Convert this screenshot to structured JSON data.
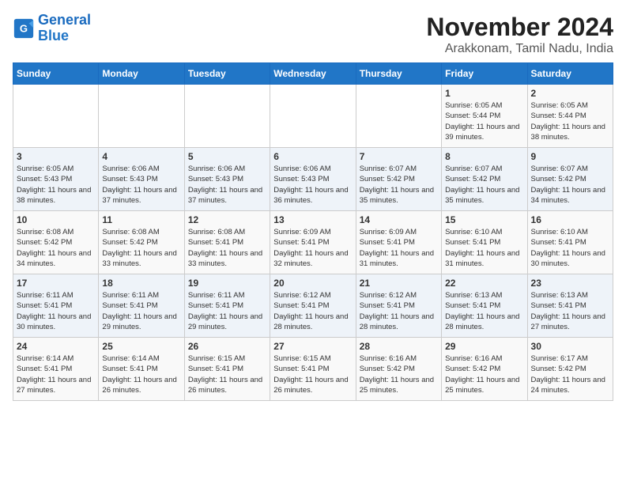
{
  "logo": {
    "line1": "General",
    "line2": "Blue"
  },
  "title": "November 2024",
  "location": "Arakkonam, Tamil Nadu, India",
  "weekdays": [
    "Sunday",
    "Monday",
    "Tuesday",
    "Wednesday",
    "Thursday",
    "Friday",
    "Saturday"
  ],
  "weeks": [
    [
      {
        "day": "",
        "info": ""
      },
      {
        "day": "",
        "info": ""
      },
      {
        "day": "",
        "info": ""
      },
      {
        "day": "",
        "info": ""
      },
      {
        "day": "",
        "info": ""
      },
      {
        "day": "1",
        "info": "Sunrise: 6:05 AM\nSunset: 5:44 PM\nDaylight: 11 hours and 39 minutes."
      },
      {
        "day": "2",
        "info": "Sunrise: 6:05 AM\nSunset: 5:44 PM\nDaylight: 11 hours and 38 minutes."
      }
    ],
    [
      {
        "day": "3",
        "info": "Sunrise: 6:05 AM\nSunset: 5:43 PM\nDaylight: 11 hours and 38 minutes."
      },
      {
        "day": "4",
        "info": "Sunrise: 6:06 AM\nSunset: 5:43 PM\nDaylight: 11 hours and 37 minutes."
      },
      {
        "day": "5",
        "info": "Sunrise: 6:06 AM\nSunset: 5:43 PM\nDaylight: 11 hours and 37 minutes."
      },
      {
        "day": "6",
        "info": "Sunrise: 6:06 AM\nSunset: 5:43 PM\nDaylight: 11 hours and 36 minutes."
      },
      {
        "day": "7",
        "info": "Sunrise: 6:07 AM\nSunset: 5:42 PM\nDaylight: 11 hours and 35 minutes."
      },
      {
        "day": "8",
        "info": "Sunrise: 6:07 AM\nSunset: 5:42 PM\nDaylight: 11 hours and 35 minutes."
      },
      {
        "day": "9",
        "info": "Sunrise: 6:07 AM\nSunset: 5:42 PM\nDaylight: 11 hours and 34 minutes."
      }
    ],
    [
      {
        "day": "10",
        "info": "Sunrise: 6:08 AM\nSunset: 5:42 PM\nDaylight: 11 hours and 34 minutes."
      },
      {
        "day": "11",
        "info": "Sunrise: 6:08 AM\nSunset: 5:42 PM\nDaylight: 11 hours and 33 minutes."
      },
      {
        "day": "12",
        "info": "Sunrise: 6:08 AM\nSunset: 5:41 PM\nDaylight: 11 hours and 33 minutes."
      },
      {
        "day": "13",
        "info": "Sunrise: 6:09 AM\nSunset: 5:41 PM\nDaylight: 11 hours and 32 minutes."
      },
      {
        "day": "14",
        "info": "Sunrise: 6:09 AM\nSunset: 5:41 PM\nDaylight: 11 hours and 31 minutes."
      },
      {
        "day": "15",
        "info": "Sunrise: 6:10 AM\nSunset: 5:41 PM\nDaylight: 11 hours and 31 minutes."
      },
      {
        "day": "16",
        "info": "Sunrise: 6:10 AM\nSunset: 5:41 PM\nDaylight: 11 hours and 30 minutes."
      }
    ],
    [
      {
        "day": "17",
        "info": "Sunrise: 6:11 AM\nSunset: 5:41 PM\nDaylight: 11 hours and 30 minutes."
      },
      {
        "day": "18",
        "info": "Sunrise: 6:11 AM\nSunset: 5:41 PM\nDaylight: 11 hours and 29 minutes."
      },
      {
        "day": "19",
        "info": "Sunrise: 6:11 AM\nSunset: 5:41 PM\nDaylight: 11 hours and 29 minutes."
      },
      {
        "day": "20",
        "info": "Sunrise: 6:12 AM\nSunset: 5:41 PM\nDaylight: 11 hours and 28 minutes."
      },
      {
        "day": "21",
        "info": "Sunrise: 6:12 AM\nSunset: 5:41 PM\nDaylight: 11 hours and 28 minutes."
      },
      {
        "day": "22",
        "info": "Sunrise: 6:13 AM\nSunset: 5:41 PM\nDaylight: 11 hours and 28 minutes."
      },
      {
        "day": "23",
        "info": "Sunrise: 6:13 AM\nSunset: 5:41 PM\nDaylight: 11 hours and 27 minutes."
      }
    ],
    [
      {
        "day": "24",
        "info": "Sunrise: 6:14 AM\nSunset: 5:41 PM\nDaylight: 11 hours and 27 minutes."
      },
      {
        "day": "25",
        "info": "Sunrise: 6:14 AM\nSunset: 5:41 PM\nDaylight: 11 hours and 26 minutes."
      },
      {
        "day": "26",
        "info": "Sunrise: 6:15 AM\nSunset: 5:41 PM\nDaylight: 11 hours and 26 minutes."
      },
      {
        "day": "27",
        "info": "Sunrise: 6:15 AM\nSunset: 5:41 PM\nDaylight: 11 hours and 26 minutes."
      },
      {
        "day": "28",
        "info": "Sunrise: 6:16 AM\nSunset: 5:42 PM\nDaylight: 11 hours and 25 minutes."
      },
      {
        "day": "29",
        "info": "Sunrise: 6:16 AM\nSunset: 5:42 PM\nDaylight: 11 hours and 25 minutes."
      },
      {
        "day": "30",
        "info": "Sunrise: 6:17 AM\nSunset: 5:42 PM\nDaylight: 11 hours and 24 minutes."
      }
    ]
  ]
}
